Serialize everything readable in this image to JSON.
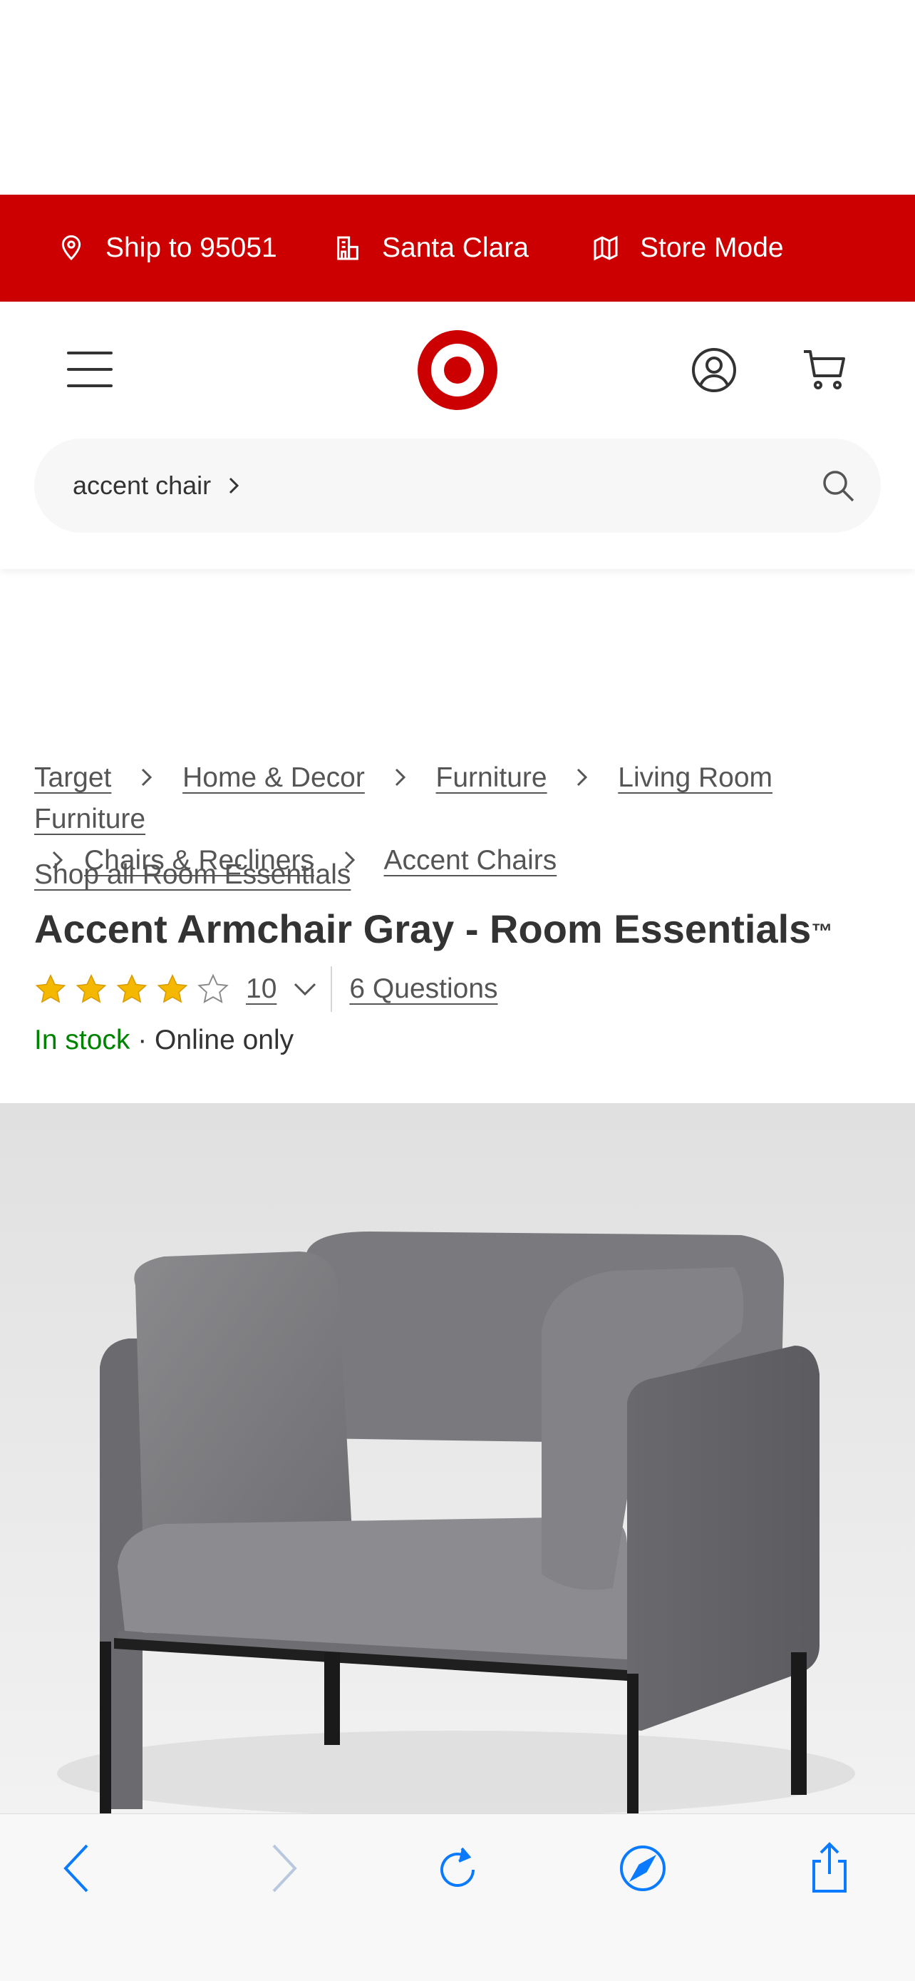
{
  "topbar": {
    "ship_to": "Ship to 95051",
    "store": "Santa Clara",
    "store_mode": "Store Mode",
    "background": "#cc0000"
  },
  "header": {
    "menu_icon": "hamburger-menu-icon",
    "logo": "target-bullseye-logo",
    "account_icon": "account-icon",
    "cart_icon": "cart-icon"
  },
  "search": {
    "value": "accent chair",
    "icon": "search-icon"
  },
  "breadcrumbs": [
    "Target",
    "Home & Decor",
    "Furniture",
    "Living Room Furniture",
    "Chairs & Recliners",
    "Accent Chairs"
  ],
  "product": {
    "shop_all": "Shop all Room Essentials",
    "title": "Accent Armchair Gray - Room Essentials",
    "trademark": "™",
    "rating_stars": 4,
    "rating_max": 5,
    "rating_count": "10",
    "questions": "6 Questions",
    "stock_status": "In stock",
    "availability": " · Online only",
    "star_color": "#f5b800",
    "stock_color": "#008300"
  },
  "browser_toolbar": {
    "icons": [
      "back-icon",
      "forward-icon",
      "reload-icon",
      "compass-icon",
      "share-icon"
    ],
    "accent": "#0a7aff"
  }
}
